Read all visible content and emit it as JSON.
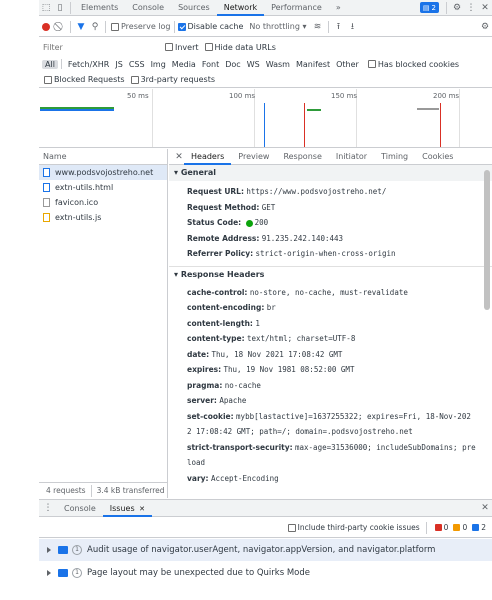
{
  "devtools": {
    "tabs": [
      "Elements",
      "Console",
      "Sources",
      "Network",
      "Performance"
    ],
    "active_tab": "Network",
    "more": "»",
    "issues_count": "2",
    "close": "✕"
  },
  "netbar": {
    "preserve_log": "Preserve log",
    "disable_cache": "Disable cache",
    "throttle": "No throttling"
  },
  "filter": {
    "placeholder": "Filter",
    "invert": "Invert",
    "hide_data_urls": "Hide data URLs"
  },
  "types": [
    "All",
    "Fetch/XHR",
    "JS",
    "CSS",
    "Img",
    "Media",
    "Font",
    "Doc",
    "WS",
    "Wasm",
    "Manifest",
    "Other"
  ],
  "has_blocked_cookies": "Has blocked cookies",
  "blocked_requests": "Blocked Requests",
  "third_party_requests": "3rd-party requests",
  "overview": {
    "ticks": [
      "50 ms",
      "100 ms",
      "150 ms",
      "200 ms"
    ]
  },
  "requests": {
    "header": "Name",
    "items": [
      {
        "name": "www.podsvojostreho.net"
      },
      {
        "name": "extn-utils.html"
      },
      {
        "name": "favicon.ico"
      },
      {
        "name": "extn-utils.js"
      }
    ],
    "summary_count": "4 requests",
    "summary_size": "3.4 kB transferred"
  },
  "detail": {
    "close": "✕",
    "tabs": [
      "Headers",
      "Preview",
      "Response",
      "Initiator",
      "Timing",
      "Cookies"
    ],
    "general_title": "General",
    "general": [
      {
        "k": "Request URL:",
        "v": "https://www.podsvojostreho.net/"
      },
      {
        "k": "Request Method:",
        "v": "GET"
      },
      {
        "k": "Status Code:",
        "v": "200"
      },
      {
        "k": "Remote Address:",
        "v": "91.235.242.140:443"
      },
      {
        "k": "Referrer Policy:",
        "v": "strict-origin-when-cross-origin"
      }
    ],
    "response_title": "Response Headers",
    "response": [
      {
        "k": "cache-control:",
        "v": "no-store, no-cache, must-revalidate"
      },
      {
        "k": "content-encoding:",
        "v": "br"
      },
      {
        "k": "content-length:",
        "v": "1"
      },
      {
        "k": "content-type:",
        "v": "text/html; charset=UTF-8"
      },
      {
        "k": "date:",
        "v": "Thu, 18 Nov 2021 17:08:42 GMT"
      },
      {
        "k": "expires:",
        "v": "Thu, 19 Nov 1981 08:52:00 GMT"
      },
      {
        "k": "pragma:",
        "v": "no-cache"
      },
      {
        "k": "server:",
        "v": "Apache"
      },
      {
        "k": "set-cookie:",
        "v": "mybb[lastactive]=1637255322; expires=Fri, 18-Nov-202"
      },
      {
        "k": "",
        "v": "2 17:08:42 GMT; path=/; domain=.podsvojostreho.net"
      },
      {
        "k": "strict-transport-security:",
        "v": "max-age=31536000; includeSubDomains; pre"
      },
      {
        "k": "",
        "v": "load"
      },
      {
        "k": "vary:",
        "v": "Accept-Encoding"
      }
    ]
  },
  "drawer": {
    "tabs": [
      "Console",
      "Issues"
    ],
    "close": "✕",
    "third_party_cookie": "Include third-party cookie issues",
    "badge_red": "0",
    "badge_yellow": "0",
    "badge_blue": "2",
    "issues": [
      {
        "count": "1",
        "text": "Audit usage of navigator.userAgent, navigator.appVersion, and navigator.platform"
      },
      {
        "count": "1",
        "text": "Page layout may be unexpected due to Quirks Mode"
      }
    ]
  }
}
